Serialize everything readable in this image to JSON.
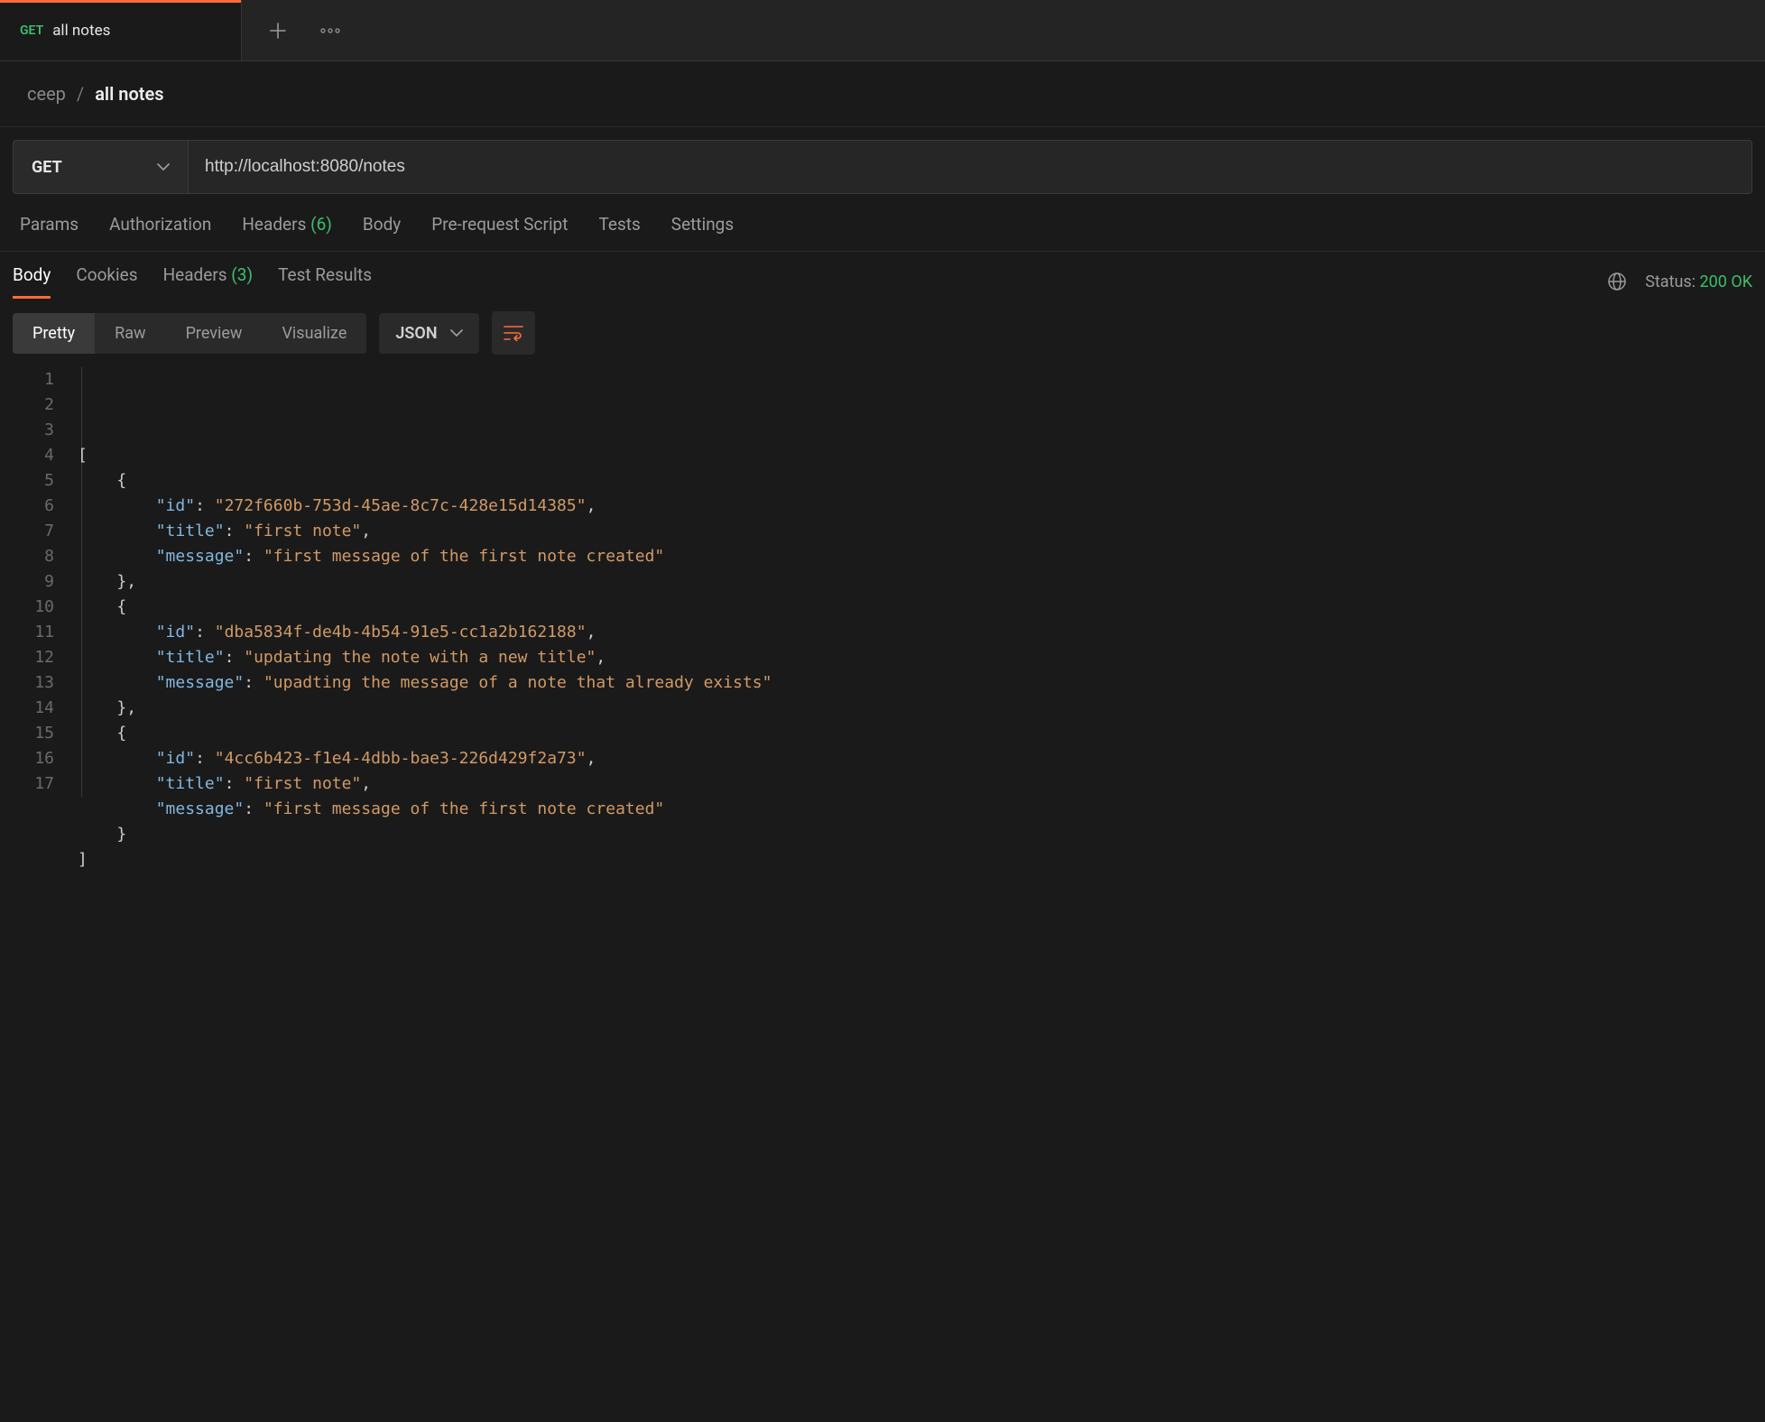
{
  "tab": {
    "method": "GET",
    "title": "all notes"
  },
  "breadcrumb": {
    "collection": "ceep",
    "request": "all notes"
  },
  "request": {
    "method": "GET",
    "url": "http://localhost:8080/notes"
  },
  "req_tabs": {
    "params": "Params",
    "authorization": "Authorization",
    "headers_label": "Headers",
    "headers_count": "(6)",
    "body": "Body",
    "prerequest": "Pre-request Script",
    "tests": "Tests",
    "settings": "Settings"
  },
  "res_tabs": {
    "body": "Body",
    "cookies": "Cookies",
    "headers_label": "Headers",
    "headers_count": "(3)",
    "test_results": "Test Results"
  },
  "status": {
    "label": "Status:",
    "value": "200 OK"
  },
  "view_modes": {
    "pretty": "Pretty",
    "raw": "Raw",
    "preview": "Preview",
    "visualize": "Visualize"
  },
  "format_dropdown": "JSON",
  "response_body": [
    {
      "id": "272f660b-753d-45ae-8c7c-428e15d14385",
      "title": "first note",
      "message": "first message of the first note created"
    },
    {
      "id": "dba5834f-de4b-4b54-91e5-cc1a2b162188",
      "title": "updating the note with a new title",
      "message": "upadting the message of a note that already exists"
    },
    {
      "id": "4cc6b423-f1e4-4dbb-bae3-226d429f2a73",
      "title": "first note",
      "message": "first message of the first note created"
    }
  ],
  "code_lines": [
    {
      "indent": 0,
      "tokens": [
        {
          "t": "punct",
          "v": "["
        }
      ]
    },
    {
      "indent": 1,
      "tokens": [
        {
          "t": "punct",
          "v": "{"
        }
      ]
    },
    {
      "indent": 2,
      "tokens": [
        {
          "t": "key",
          "v": "\"id\""
        },
        {
          "t": "colon",
          "v": ":"
        },
        {
          "t": "sp",
          "v": " "
        },
        {
          "t": "string",
          "v": "\"272f660b-753d-45ae-8c7c-428e15d14385\""
        },
        {
          "t": "punct",
          "v": ","
        }
      ]
    },
    {
      "indent": 2,
      "tokens": [
        {
          "t": "key",
          "v": "\"title\""
        },
        {
          "t": "colon",
          "v": ":"
        },
        {
          "t": "sp",
          "v": " "
        },
        {
          "t": "string",
          "v": "\"first note\""
        },
        {
          "t": "punct",
          "v": ","
        }
      ]
    },
    {
      "indent": 2,
      "tokens": [
        {
          "t": "key",
          "v": "\"message\""
        },
        {
          "t": "colon",
          "v": ":"
        },
        {
          "t": "sp",
          "v": " "
        },
        {
          "t": "string",
          "v": "\"first message of the first note created\""
        }
      ]
    },
    {
      "indent": 1,
      "tokens": [
        {
          "t": "punct",
          "v": "},"
        }
      ]
    },
    {
      "indent": 1,
      "tokens": [
        {
          "t": "punct",
          "v": "{"
        }
      ]
    },
    {
      "indent": 2,
      "tokens": [
        {
          "t": "key",
          "v": "\"id\""
        },
        {
          "t": "colon",
          "v": ":"
        },
        {
          "t": "sp",
          "v": " "
        },
        {
          "t": "string",
          "v": "\"dba5834f-de4b-4b54-91e5-cc1a2b162188\""
        },
        {
          "t": "punct",
          "v": ","
        }
      ]
    },
    {
      "indent": 2,
      "tokens": [
        {
          "t": "key",
          "v": "\"title\""
        },
        {
          "t": "colon",
          "v": ":"
        },
        {
          "t": "sp",
          "v": " "
        },
        {
          "t": "string",
          "v": "\"updating the note with a new title\""
        },
        {
          "t": "punct",
          "v": ","
        }
      ]
    },
    {
      "indent": 2,
      "tokens": [
        {
          "t": "key",
          "v": "\"message\""
        },
        {
          "t": "colon",
          "v": ":"
        },
        {
          "t": "sp",
          "v": " "
        },
        {
          "t": "string",
          "v": "\"upadting the message of a note that already exists\""
        }
      ]
    },
    {
      "indent": 1,
      "tokens": [
        {
          "t": "punct",
          "v": "},"
        }
      ]
    },
    {
      "indent": 1,
      "tokens": [
        {
          "t": "punct",
          "v": "{"
        }
      ]
    },
    {
      "indent": 2,
      "tokens": [
        {
          "t": "key",
          "v": "\"id\""
        },
        {
          "t": "colon",
          "v": ":"
        },
        {
          "t": "sp",
          "v": " "
        },
        {
          "t": "string",
          "v": "\"4cc6b423-f1e4-4dbb-bae3-226d429f2a73\""
        },
        {
          "t": "punct",
          "v": ","
        }
      ]
    },
    {
      "indent": 2,
      "tokens": [
        {
          "t": "key",
          "v": "\"title\""
        },
        {
          "t": "colon",
          "v": ":"
        },
        {
          "t": "sp",
          "v": " "
        },
        {
          "t": "string",
          "v": "\"first note\""
        },
        {
          "t": "punct",
          "v": ","
        }
      ]
    },
    {
      "indent": 2,
      "tokens": [
        {
          "t": "key",
          "v": "\"message\""
        },
        {
          "t": "colon",
          "v": ":"
        },
        {
          "t": "sp",
          "v": " "
        },
        {
          "t": "string",
          "v": "\"first message of the first note created\""
        }
      ]
    },
    {
      "indent": 1,
      "tokens": [
        {
          "t": "punct",
          "v": "}"
        }
      ]
    },
    {
      "indent": 0,
      "tokens": [
        {
          "t": "punct",
          "v": "]"
        }
      ]
    }
  ]
}
